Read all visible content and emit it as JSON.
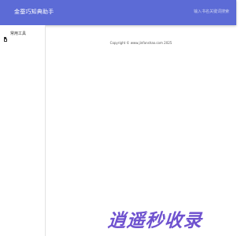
{
  "header": {
    "app_title": "金蚕巧知典助手",
    "search_placeholder": "输入书名关键词搜索"
  },
  "sidebar": {
    "items": [
      {
        "label": "常用工具",
        "icon": "tool-icon"
      }
    ]
  },
  "main": {
    "copyright": "Copyright © www.jinfanshao.com 2025"
  },
  "watermark": {
    "text": "逍遥秒收录"
  },
  "colors": {
    "header_bg": "#5c6bd6",
    "watermark": "#6f52cf"
  }
}
